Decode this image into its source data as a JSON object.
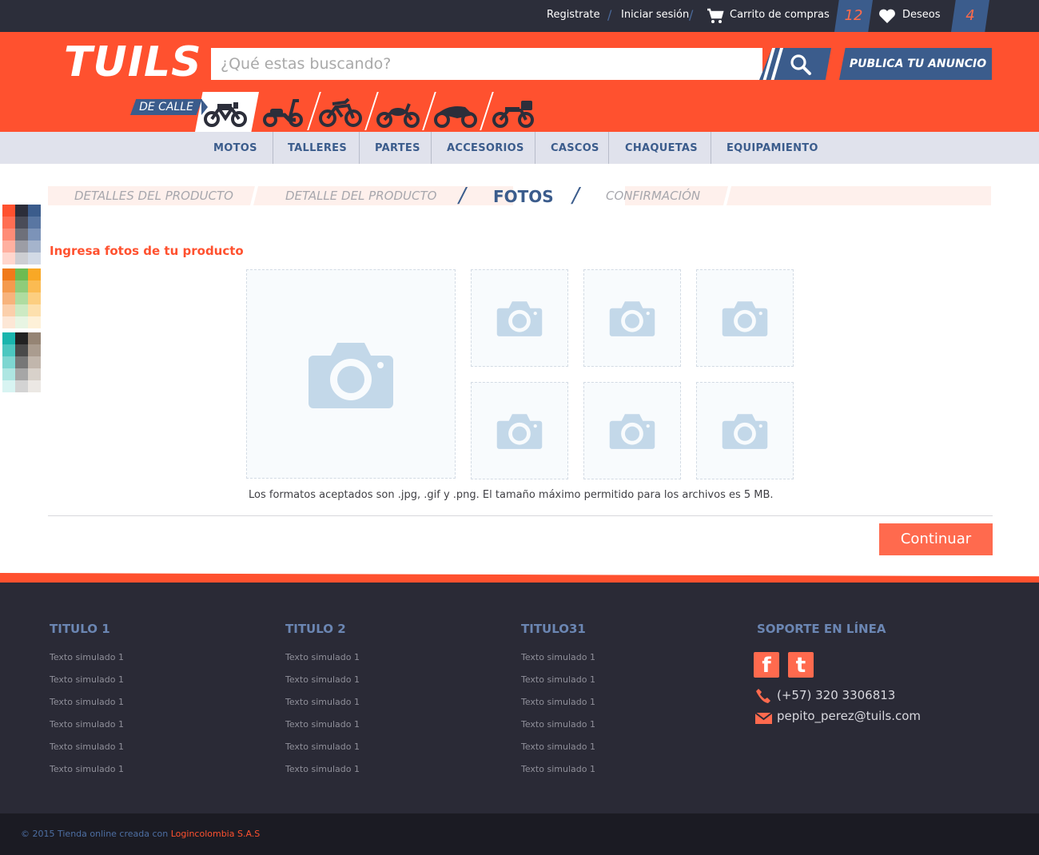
{
  "topbar": {
    "register": "Registrate",
    "login": "Iniciar sesión",
    "cart_label": "Carrito de compras",
    "cart_count": "12",
    "wishlist_label": "Deseos",
    "wishlist_count": "4"
  },
  "header": {
    "logo": "TUILS",
    "search_placeholder": "¿Qué estas buscando?",
    "publish_label": "PUBLICA TU ANUNCIO",
    "category_tag": "DE CALLE"
  },
  "nav": [
    "MOTOS",
    "TALLERES",
    "PARTES",
    "ACCESORIOS",
    "CASCOS",
    "CHAQUETAS",
    "EQUIPAMIENTO"
  ],
  "steps": {
    "step1": "DETALLES DEL PRODUCTO",
    "step2": "DETALLE DEL PRODUCTO",
    "step3": "FOTOS",
    "step4": "CONFIRMACIÓN"
  },
  "photos": {
    "title": "Ingresa fotos de tu producto",
    "formats_note": "Los formatos aceptados son .jpg, .gif y .png. El tamaño máximo permitido para los archivos es 5 MB.",
    "continue_label": "Continuar"
  },
  "footer": {
    "col1": {
      "title": "TITULO 1",
      "links": [
        "Texto simulado 1",
        "Texto simulado 1",
        "Texto simulado 1",
        "Texto simulado 1",
        "Texto simulado 1",
        "Texto simulado 1"
      ]
    },
    "col2": {
      "title": "TITULO 2",
      "links": [
        "Texto simulado 1",
        "Texto simulado 1",
        "Texto simulado 1",
        "Texto simulado 1",
        "Texto simulado 1",
        "Texto simulado 1"
      ]
    },
    "col3": {
      "title": "TITULO31",
      "links": [
        "Texto simulado 1",
        "Texto simulado 1",
        "Texto simulado 1",
        "Texto simulado 1",
        "Texto simulado 1",
        "Texto simulado 1"
      ]
    },
    "support": {
      "title": "SOPORTE EN LÍNEA",
      "phone": "(+57) 320 3306813",
      "email": "pepito_perez@tuils.com"
    },
    "copyright_prefix": "© 2015 Tienda online creada con ",
    "copyright_company": "Logincolombia S.A.S"
  },
  "colors": {
    "brand_orange": "#ff512f",
    "brand_blue": "#3b5c8c",
    "dark_bg": "#2a2a36"
  },
  "icons": {
    "cart": "cart-icon",
    "wishlist": "heart-icon",
    "search": "search-icon",
    "photo_slot": "camera-icon",
    "facebook": "facebook-icon",
    "twitter": "twitter-icon",
    "phone": "phone-icon",
    "email": "mail-icon"
  }
}
